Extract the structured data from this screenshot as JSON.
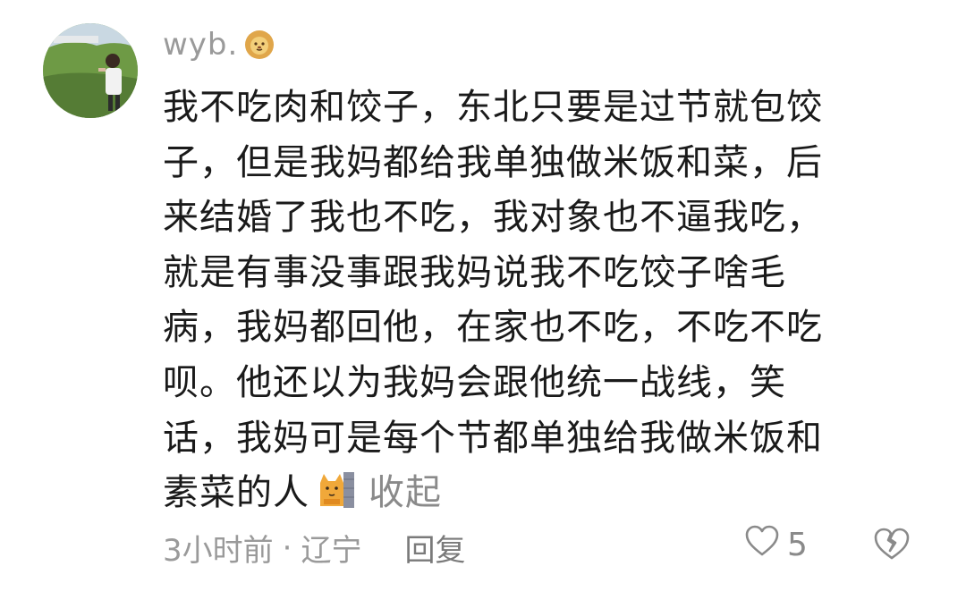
{
  "comment": {
    "username": "wyb.",
    "username_badge_icon": "lion-face-icon",
    "lines": [
      "我不吃肉和饺子，东北只要是过节就包饺",
      "子，但是我妈都给我单独做米饭和菜，后",
      "来结婚了我也不吃，我对象也不逼我吃，",
      "就是有事没事跟我妈说我不吃饺子啥毛",
      "病，我妈都回他，在家也不吃，不吃不吃",
      "呗。他还以为我妈会跟他统一战线，笑",
      "话，我妈可是每个节都单独给我做米饭和",
      "素菜的人"
    ],
    "inline_emoji": "cat-wall-emoji-icon",
    "collapse_label": "收起",
    "time": "3小时前",
    "separator": "·",
    "location": "辽宁",
    "reply_label": "回复",
    "like_count": "5"
  }
}
